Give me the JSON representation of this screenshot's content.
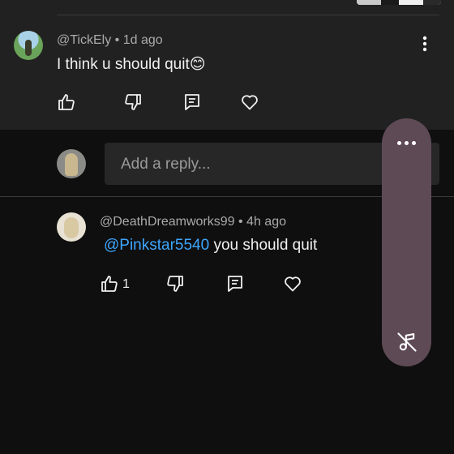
{
  "comment": {
    "username": "@TickEly",
    "time": "1d ago",
    "text": "I think u should quit😊"
  },
  "reply_box": {
    "placeholder": "Add a reply..."
  },
  "reply": {
    "username": "@DeathDreamworks99",
    "time": "4h ago",
    "mention": "@Pinkstar5540",
    "text": "you should quit",
    "like_count": "1"
  },
  "meta_separator": "•",
  "icons": {
    "like": "thumbs-up-icon",
    "dislike": "thumbs-down-icon",
    "reply": "reply-icon",
    "heart": "heart-icon",
    "more": "more-vertical-icon",
    "pill_more": "more-horizontal-icon",
    "music_off": "music-off-icon"
  },
  "colors": {
    "background": "#0f0f0f",
    "comment_surface": "#212121",
    "mention": "#3ea6ff",
    "pill": "#5e4a55"
  }
}
